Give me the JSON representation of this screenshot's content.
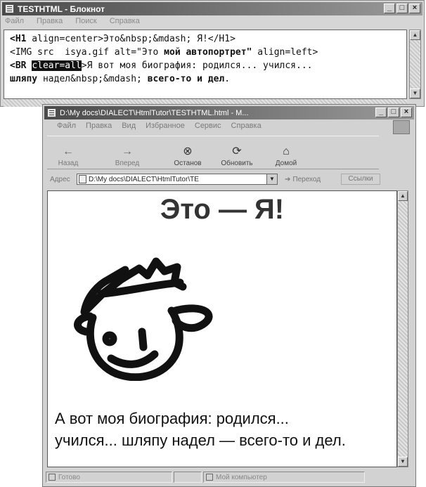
{
  "notepad": {
    "title": "TESTHTML - Блокнот",
    "menu": [
      "Файл",
      "Правка",
      "Поиск",
      "Справка"
    ],
    "code": {
      "line1": {
        "tag": "<H1",
        "rest": " align=center>Это&nbsp;&mdash; Я!</H1>"
      },
      "line2": {
        "start": "<IMG src  ",
        "mid": "isya.gif alt=\"Это ",
        "bold": "мой автопортрет\"",
        "end": " align=left>"
      },
      "line3": {
        "tag": "<BR",
        "space": " ",
        "selected": "clear=all",
        "rest": ">Я вот моя биография: родился... учился..."
      },
      "line4": {
        "bold1": "шляпу",
        "mid": " надел&nbsp;&mdash; ",
        "bold2": "всего-то и дел",
        "end": "."
      }
    }
  },
  "browser": {
    "title": "D:\\My docs\\DIALECT\\HtmlTutor\\TESTHTML.html - M...",
    "menu": [
      "Файл",
      "Правка",
      "Вид",
      "Избранное",
      "Сервис",
      "Справка"
    ],
    "toolbar": {
      "back": "Назад",
      "forward": "Вперед",
      "stop": "Останов",
      "refresh": "Обновить",
      "home": "Домой"
    },
    "address_label": "Адрес",
    "address_value": "D:\\My docs\\DIALECT\\HtmlTutor\\TE",
    "go_label": "Переход",
    "links_label": "Ссылки",
    "page": {
      "heading": "Это — Я!",
      "bio": "А вот моя биография: родился... учился... шляпу надел — всего-то и дел."
    },
    "status": {
      "ready": "Готово",
      "zone": "Мой компьютер"
    }
  },
  "colors": {
    "selection": "#111111",
    "title_gradient": "#4a4a4a"
  },
  "icons": [
    "app-icon",
    "back-icon",
    "forward-icon",
    "stop-icon",
    "refresh-icon",
    "home-icon",
    "page-icon",
    "go-icon",
    "computer-icon"
  ]
}
